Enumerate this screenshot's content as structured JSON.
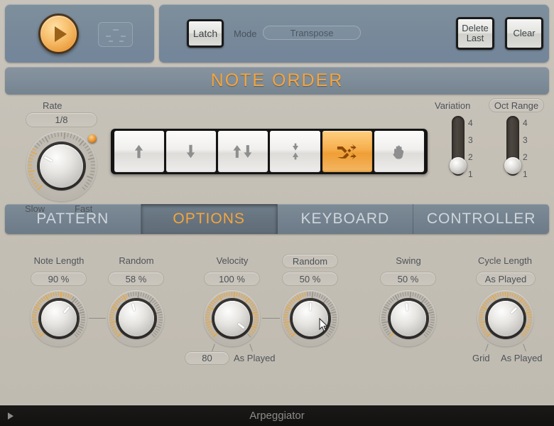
{
  "app": {
    "footer_title": "Arpeggiator",
    "footer_play_icon": "play-triangle-icon"
  },
  "transport": {
    "play_icon": "play-icon",
    "midi_pattern_icon": "midi-pattern-icon"
  },
  "controls": {
    "latch_label": "Latch",
    "mode_label": "Mode",
    "mode_value": "Transpose",
    "delete_last_line1": "Delete",
    "delete_last_line2": "Last",
    "clear_label": "Clear"
  },
  "note_order": {
    "header": "NOTE ORDER",
    "rate_label": "Rate",
    "rate_value": "1/8",
    "rate_min_label": "Slow",
    "rate_max_label": "Fast",
    "buttons": [
      {
        "name": "note-order-up",
        "icon": "arrow-up-icon",
        "active": false
      },
      {
        "name": "note-order-down",
        "icon": "arrow-down-icon",
        "active": false
      },
      {
        "name": "note-order-up-down",
        "icon": "arrow-up-down-icon",
        "active": false
      },
      {
        "name": "note-order-down-up",
        "icon": "arrow-inward-icon",
        "active": false
      },
      {
        "name": "note-order-random",
        "icon": "shuffle-icon",
        "active": true
      },
      {
        "name": "note-order-as-played",
        "icon": "hand-icon",
        "active": false
      }
    ],
    "variation_label": "Variation",
    "variation_value": 1,
    "oct_range_label": "Oct Range",
    "oct_range_value": 1,
    "slider_scale": [
      "4",
      "3",
      "2",
      "1"
    ]
  },
  "tabs": [
    {
      "label": "PATTERN",
      "active": false
    },
    {
      "label": "OPTIONS",
      "active": true
    },
    {
      "label": "KEYBOARD",
      "active": false
    },
    {
      "label": "CONTROLLER",
      "active": false
    }
  ],
  "options": {
    "note_length": {
      "label": "Note Length",
      "value": "90 %"
    },
    "note_length_random": {
      "label": "Random",
      "value": "58 %"
    },
    "velocity": {
      "label": "Velocity",
      "value": "100 %",
      "min_label": "80",
      "max_label": "As Played"
    },
    "velocity_random": {
      "label": "Random",
      "value": "50 %"
    },
    "swing": {
      "label": "Swing",
      "value": "50 %"
    },
    "cycle_length": {
      "label": "Cycle Length",
      "value": "As Played",
      "min_label": "Grid",
      "max_label": "As Played"
    }
  },
  "colors": {
    "accent": "#f5a53c",
    "panel_blue": "#78899a",
    "body_beige": "#c5c0b6",
    "knob_arc": "#e8a63f"
  }
}
